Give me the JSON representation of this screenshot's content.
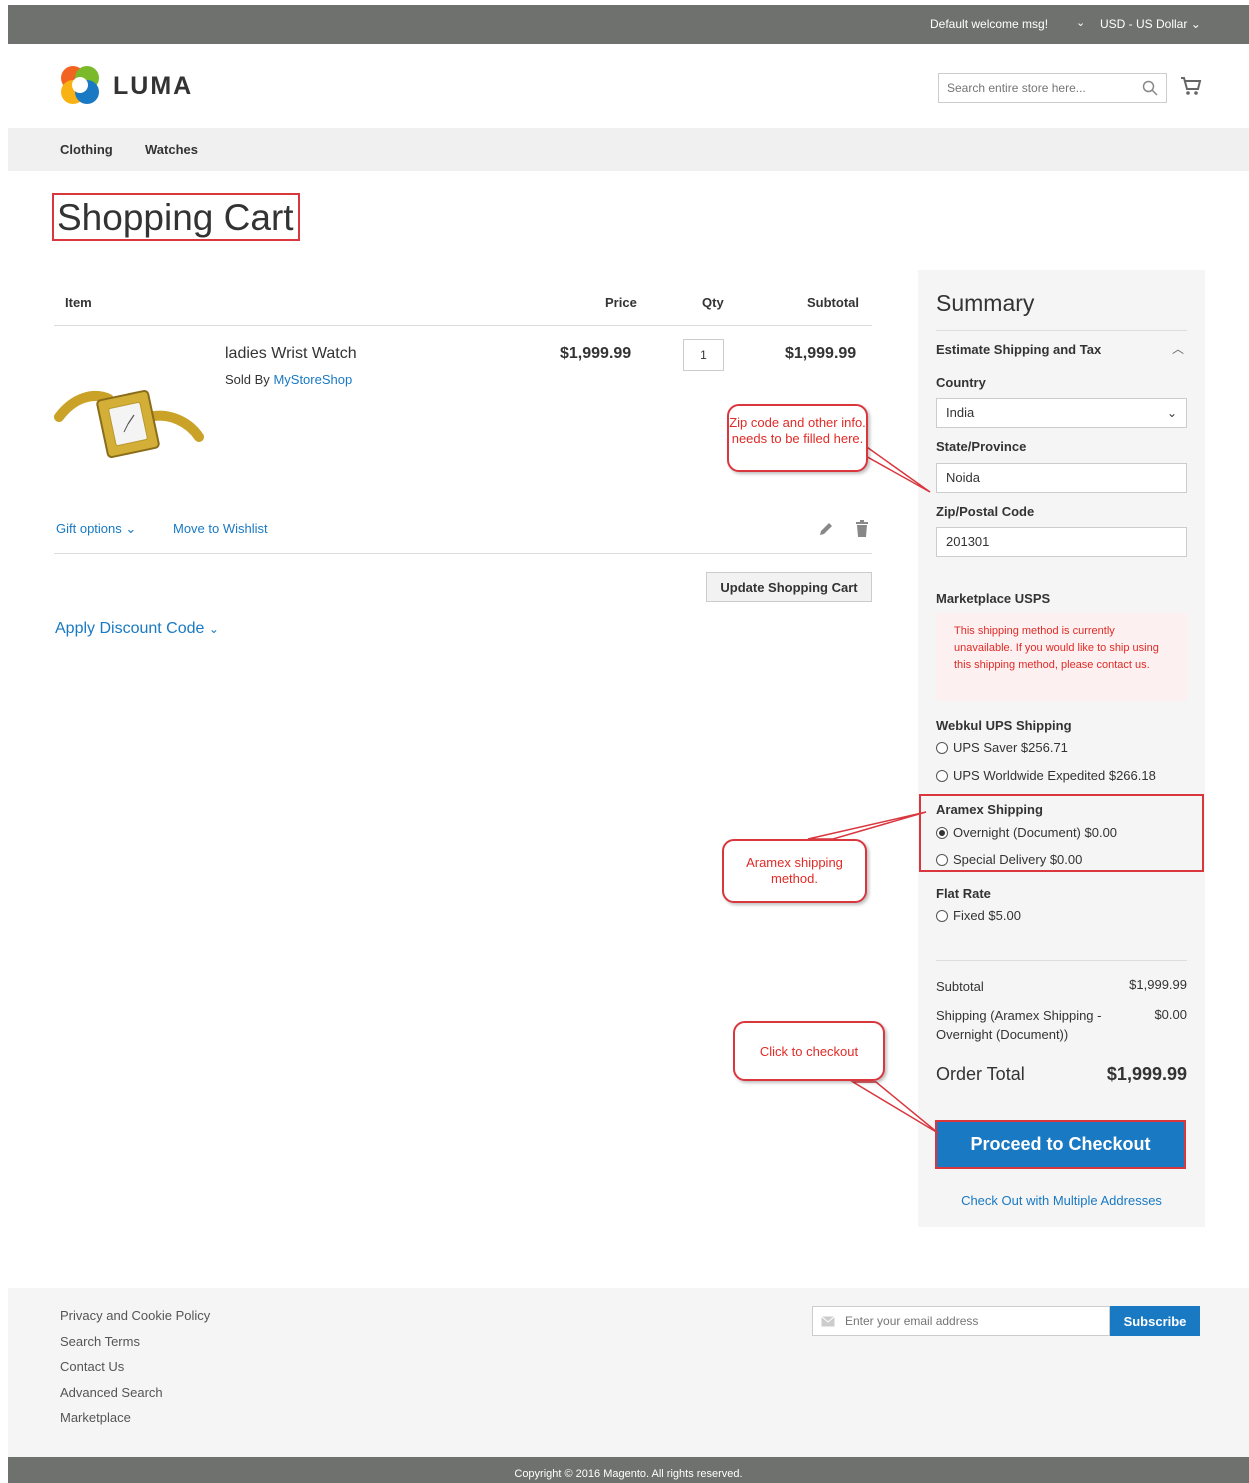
{
  "topbar": {
    "welcome": "Default welcome msg!",
    "currency": "USD - US Dollar"
  },
  "header": {
    "logo_text": "LUMA",
    "search_placeholder": "Search entire store here..."
  },
  "nav": {
    "items": [
      "Clothing",
      "Watches"
    ]
  },
  "page_title": "Shopping Cart",
  "cart": {
    "columns": {
      "item": "Item",
      "price": "Price",
      "qty": "Qty",
      "subtotal": "Subtotal"
    },
    "items": [
      {
        "name": "ladies Wrist Watch",
        "sold_by_label": "Sold By",
        "seller": "MyStoreShop",
        "price": "$1,999.99",
        "qty": "1",
        "subtotal": "$1,999.99"
      }
    ],
    "gift_options": "Gift options",
    "move_to_wishlist": "Move to Wishlist",
    "update_button": "Update Shopping Cart",
    "apply_discount": "Apply Discount Code"
  },
  "summary": {
    "title": "Summary",
    "estimate_title": "Estimate Shipping and Tax",
    "country_label": "Country",
    "country_value": "India",
    "state_label": "State/Province",
    "state_value": "Noida",
    "zip_label": "Zip/Postal Code",
    "zip_value": "201301",
    "marketplace_title": "Marketplace USPS",
    "marketplace_notice": "This shipping method is currently unavailable. If you would like to ship using this shipping method, please contact us.",
    "ups_title": "Webkul UPS Shipping",
    "ups_options": [
      "UPS Saver $256.71",
      "UPS Worldwide Expedited $266.18"
    ],
    "aramex_title": "Aramex Shipping",
    "aramex_options": [
      "Overnight (Document) $0.00",
      "Special Delivery $0.00"
    ],
    "flat_title": "Flat Rate",
    "flat_options": [
      "Fixed $5.00"
    ],
    "subtotal_label": "Subtotal",
    "subtotal_value": "$1,999.99",
    "shipping_label": "Shipping (Aramex Shipping - Overnight (Document))",
    "shipping_value": "$0.00",
    "order_total_label": "Order Total",
    "order_total_value": "$1,999.99",
    "checkout_button": "Proceed to Checkout",
    "multi_address": "Check Out with Multiple Addresses"
  },
  "callouts": {
    "zip": "Zip code and other info. needs to be filled here.",
    "aramex": "Aramex shipping method.",
    "checkout": "Click to checkout"
  },
  "footer": {
    "links": [
      "Privacy and Cookie Policy",
      "Search Terms",
      "Contact Us",
      "Advanced Search",
      "Marketplace"
    ],
    "email_placeholder": "Enter your email address",
    "subscribe": "Subscribe",
    "copyright": "Copyright © 2016 Magento. All rights reserved."
  },
  "colors": {
    "link_blue": "#1979c3",
    "topbar_gray": "#6e716e",
    "annotation_red": "#d9363e"
  }
}
